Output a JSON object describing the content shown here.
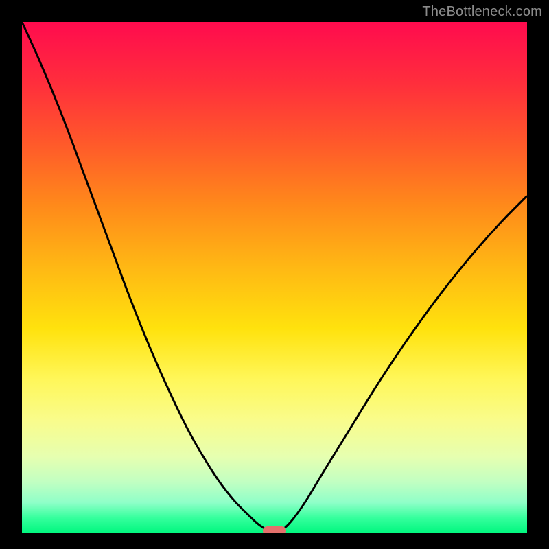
{
  "watermark": "TheBottleneck.com",
  "colors": {
    "frame_bg": "#000000",
    "pill": "#e4716c",
    "curve_stroke": "#000000",
    "watermark_text": "#8b8b8b"
  },
  "chart_data": {
    "type": "line",
    "title": "",
    "xlabel": "",
    "ylabel": "",
    "xlim": [
      0,
      100
    ],
    "ylim": [
      0,
      100
    ],
    "x": [
      0,
      3,
      6,
      9,
      12,
      15,
      18,
      21,
      24,
      27,
      30,
      33,
      36,
      39,
      42,
      45,
      47,
      49,
      51,
      53,
      56,
      60,
      65,
      70,
      75,
      80,
      85,
      90,
      95,
      100
    ],
    "values": [
      100,
      93.5,
      86.5,
      79,
      71,
      63,
      55,
      47,
      39.5,
      32.5,
      26,
      20,
      14.8,
      10.2,
      6.4,
      3.4,
      1.6,
      0.5,
      0.5,
      2.0,
      6.0,
      12.5,
      20.5,
      28.5,
      36.0,
      43.0,
      49.5,
      55.5,
      61.0,
      66.0
    ],
    "minimum_marker": {
      "x": 50,
      "y": 0
    },
    "annotations": []
  }
}
